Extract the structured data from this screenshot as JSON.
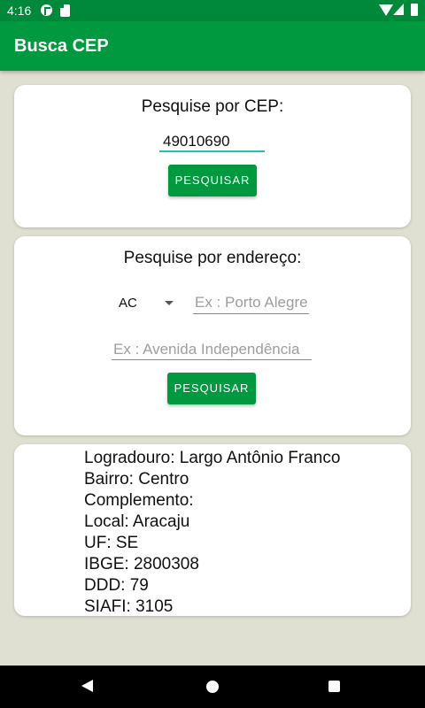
{
  "status_bar": {
    "time": "4:16"
  },
  "app_bar": {
    "title": "Busca CEP"
  },
  "cep_card": {
    "title": "Pesquise por CEP:",
    "cep_value": "49010690",
    "button_label": "PESQUISAR"
  },
  "address_card": {
    "title": "Pesquise por endereço:",
    "uf_selected": "AC",
    "city_placeholder": "Ex : Porto Alegre",
    "street_placeholder": "Ex : Avenida Independência",
    "button_label": "PESQUISAR"
  },
  "result_card": {
    "lines": [
      "Logradouro: Largo Antônio Franco",
      "Bairro: Centro",
      "Complemento:",
      "Local: Aracaju",
      "UF: SE",
      "IBGE: 2800308",
      "DDD: 79",
      "SIAFI: 3105"
    ]
  },
  "colors": {
    "status_bar": "#00893a",
    "app_bar": "#00993f",
    "button": "#00993f",
    "input_underline_focus": "#26bfb5",
    "background": "#e0e0d2"
  },
  "icons": {
    "status": [
      "notification-icon",
      "sd-card-icon",
      "wifi-icon",
      "signal-icon",
      "battery-icon"
    ],
    "nav": [
      "back-icon",
      "home-icon",
      "recents-icon"
    ]
  }
}
